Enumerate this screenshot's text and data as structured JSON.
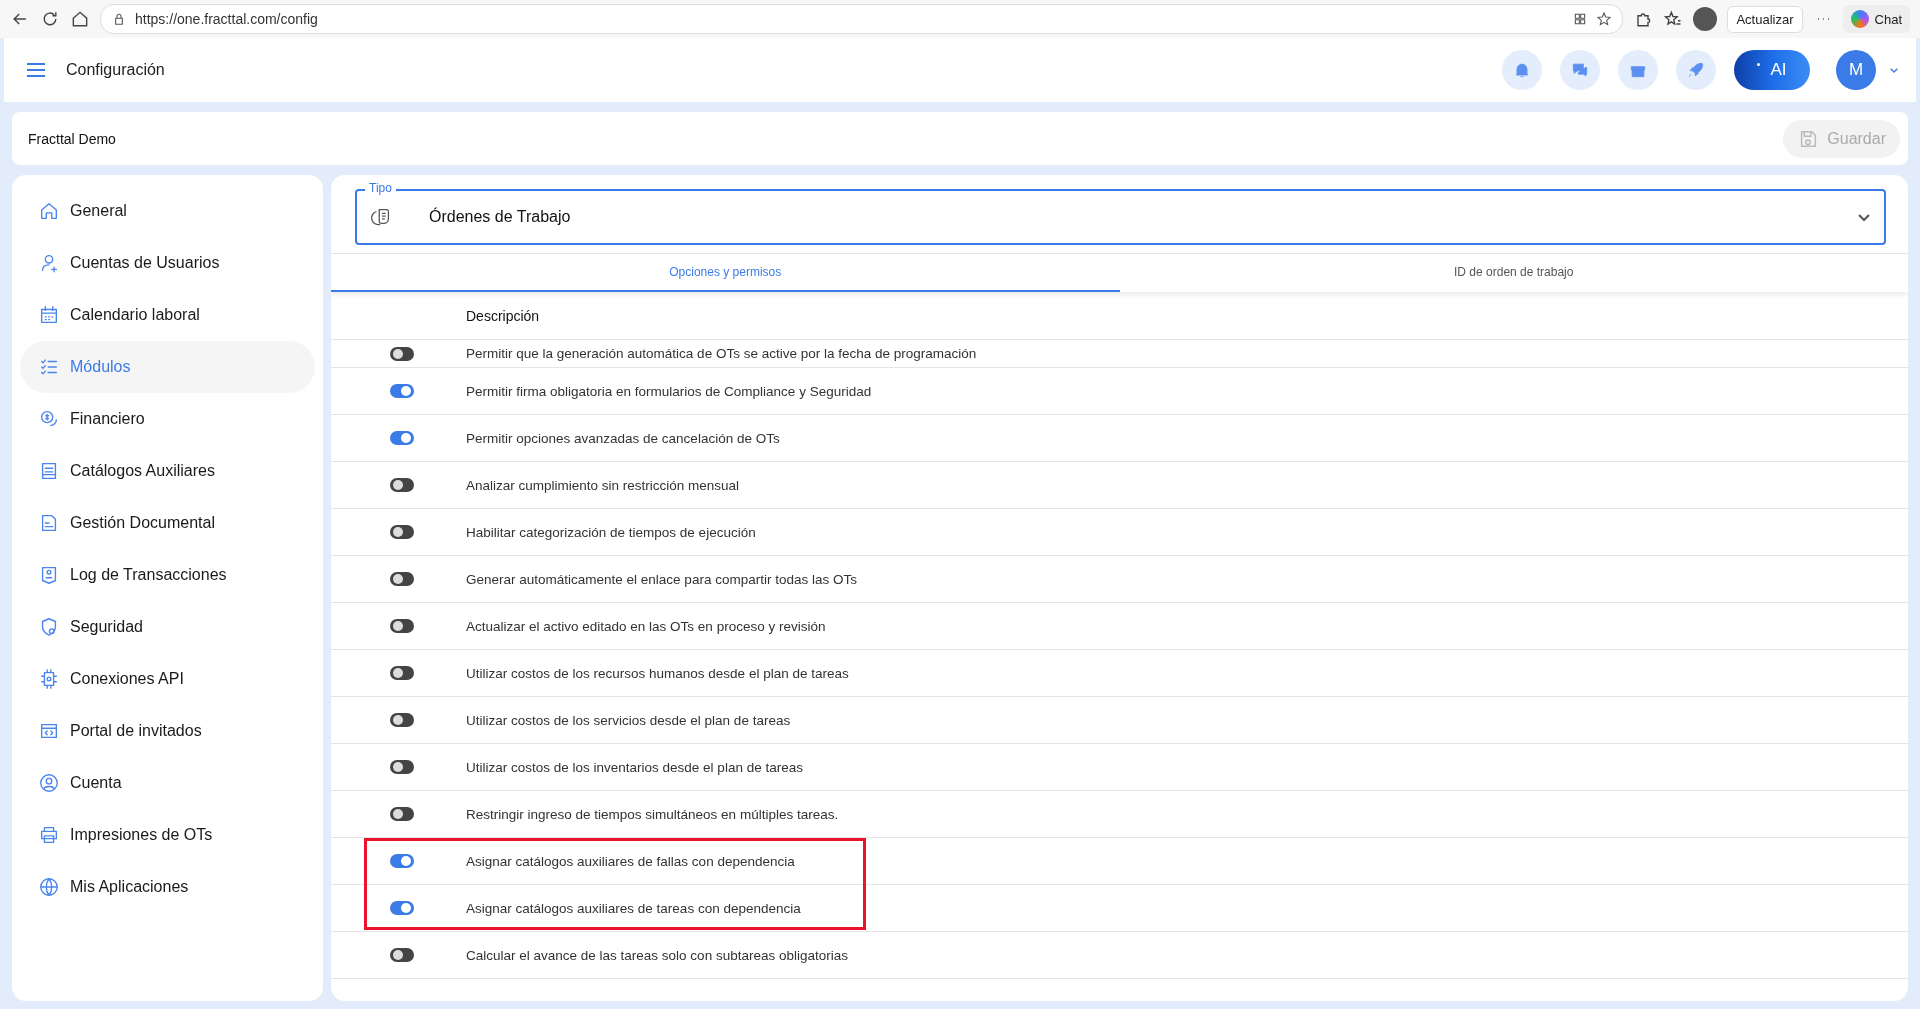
{
  "browser": {
    "url": "https://one.fracttal.com/config",
    "update_label": "Actualizar",
    "chat_label": "Chat"
  },
  "header": {
    "title": "Configuración",
    "ai_label": "AI",
    "avatar": "M"
  },
  "company": {
    "name": "Fracttal Demo",
    "save_label": "Guardar"
  },
  "sidebar": {
    "items": [
      {
        "label": "General",
        "selected": false
      },
      {
        "label": "Cuentas de Usuarios",
        "selected": false
      },
      {
        "label": "Calendario laboral",
        "selected": false
      },
      {
        "label": "Módulos",
        "selected": true
      },
      {
        "label": "Financiero",
        "selected": false
      },
      {
        "label": "Catálogos Auxiliares",
        "selected": false
      },
      {
        "label": "Gestión Documental",
        "selected": false
      },
      {
        "label": "Log de Transacciones",
        "selected": false
      },
      {
        "label": "Seguridad",
        "selected": false
      },
      {
        "label": "Conexiones API",
        "selected": false
      },
      {
        "label": "Portal de invitados",
        "selected": false
      },
      {
        "label": "Cuenta",
        "selected": false
      },
      {
        "label": "Impresiones de OTs",
        "selected": false
      },
      {
        "label": "Mis Aplicaciones",
        "selected": false
      }
    ]
  },
  "type_field": {
    "label": "Tipo",
    "value": "Órdenes de Trabajo"
  },
  "tabs": [
    {
      "label": "Opciones y permisos",
      "selected": true
    },
    {
      "label": "ID de orden de trabajo",
      "selected": false
    }
  ],
  "table": {
    "column": "Descripción",
    "rows": [
      {
        "text": "Permitir que la generación automática de OTs se active por la fecha de programación",
        "on": false,
        "highlighted": false
      },
      {
        "text": "Permitir firma obligatoria en formularios de Compliance y Seguridad",
        "on": true,
        "highlighted": false
      },
      {
        "text": "Permitir opciones avanzadas de cancelación de OTs",
        "on": true,
        "highlighted": false
      },
      {
        "text": "Analizar cumplimiento sin restricción mensual",
        "on": false,
        "highlighted": false
      },
      {
        "text": "Habilitar categorización de tiempos de ejecución",
        "on": false,
        "highlighted": false
      },
      {
        "text": "Generar automáticamente el enlace para compartir todas las OTs",
        "on": false,
        "highlighted": false
      },
      {
        "text": "Actualizar el activo editado en las OTs en proceso y revisión",
        "on": false,
        "highlighted": false
      },
      {
        "text": "Utilizar costos de los recursos humanos desde el plan de tareas",
        "on": false,
        "highlighted": false
      },
      {
        "text": "Utilizar costos de los servicios desde el plan de tareas",
        "on": false,
        "highlighted": false
      },
      {
        "text": "Utilizar costos de los inventarios desde el plan de tareas",
        "on": false,
        "highlighted": false
      },
      {
        "text": "Restringir ingreso de tiempos simultáneos en múltiples tareas.",
        "on": false,
        "highlighted": false
      },
      {
        "text": "Asignar catálogos auxiliares de fallas con dependencia",
        "on": true,
        "highlighted": true
      },
      {
        "text": "Asignar catálogos auxiliares de tareas con dependencia",
        "on": true,
        "highlighted": true
      },
      {
        "text": "Calcular el avance de las tareas solo con subtareas obligatorias",
        "on": false,
        "highlighted": false
      }
    ]
  }
}
